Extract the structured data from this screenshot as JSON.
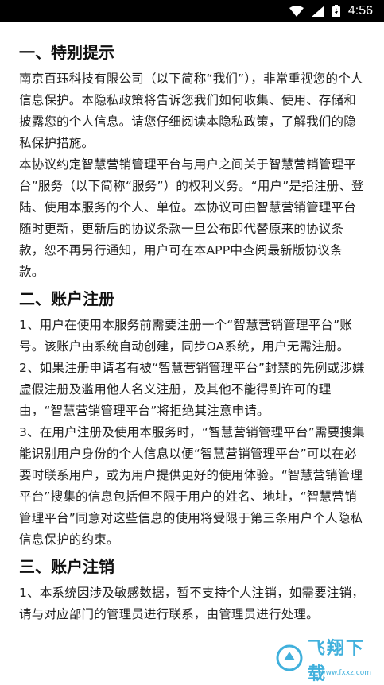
{
  "status_bar": {
    "time": "4:56"
  },
  "sections": [
    {
      "title": "一、特别提示",
      "paragraphs": [
        "南京百珏科技有限公司（以下简称“我们”），非常重视您的个人信息保护。本隐私政策将告诉您我们如何收集、使用、存储和披露您的个人信息。请您仔细阅读本隐私政策，了解我们的隐私保护措施。",
        "本协议约定智慧营销管理平台与用户之间关于智慧营销管理平台”服务（以下简称“服务”）的权利义务。“用户”是指注册、登陆、使用本服务的个人、单位。本协议可由智慧营销管理平台随时更新，更新后的协议条款一旦公布即代替原来的协议条款，恕不再另行通知，用户可在本APP中查阅最新版协议条款。"
      ]
    },
    {
      "title": "二、账户注册",
      "paragraphs": [
        "1、用户在使用本服务前需要注册一个“智慧营销管理平台”账号。该账户由系统自动创建，同步OA系统，用户无需注册。",
        "2、如果注册申请者有被“智慧营销管理平台”封禁的先例或涉嫌虚假注册及滥用他人名义注册，及其他不能得到许可的理由，“智慧营销管理平台”将拒绝其注意申请。",
        "3、在用户注册及使用本服务时，“智慧营销管理平台”需要搜集能识别用户身份的个人信息以便“智慧营销管理平台”可以在必要时联系用户，或为用户提供更好的使用体验。“智慧营销管理平台”搜集的信息包括但不限于用户的姓名、地址，“智慧营销管理平台”同意对这些信息的使用将受限于第三条用户个人隐私信息保护的约束。"
      ]
    },
    {
      "title": "三、账户注销",
      "paragraphs": [
        "1、本系统因涉及敏感数据，暂不支持个人注销，如需要注销，请与对应部门的管理员进行联系，由管理员进行处理。"
      ]
    }
  ],
  "watermark": {
    "text": "飞翔下载",
    "sub": "www.fxxz.com"
  },
  "colors": {
    "status_bar_bg": "#000000",
    "watermark": "#1fa3d6"
  }
}
